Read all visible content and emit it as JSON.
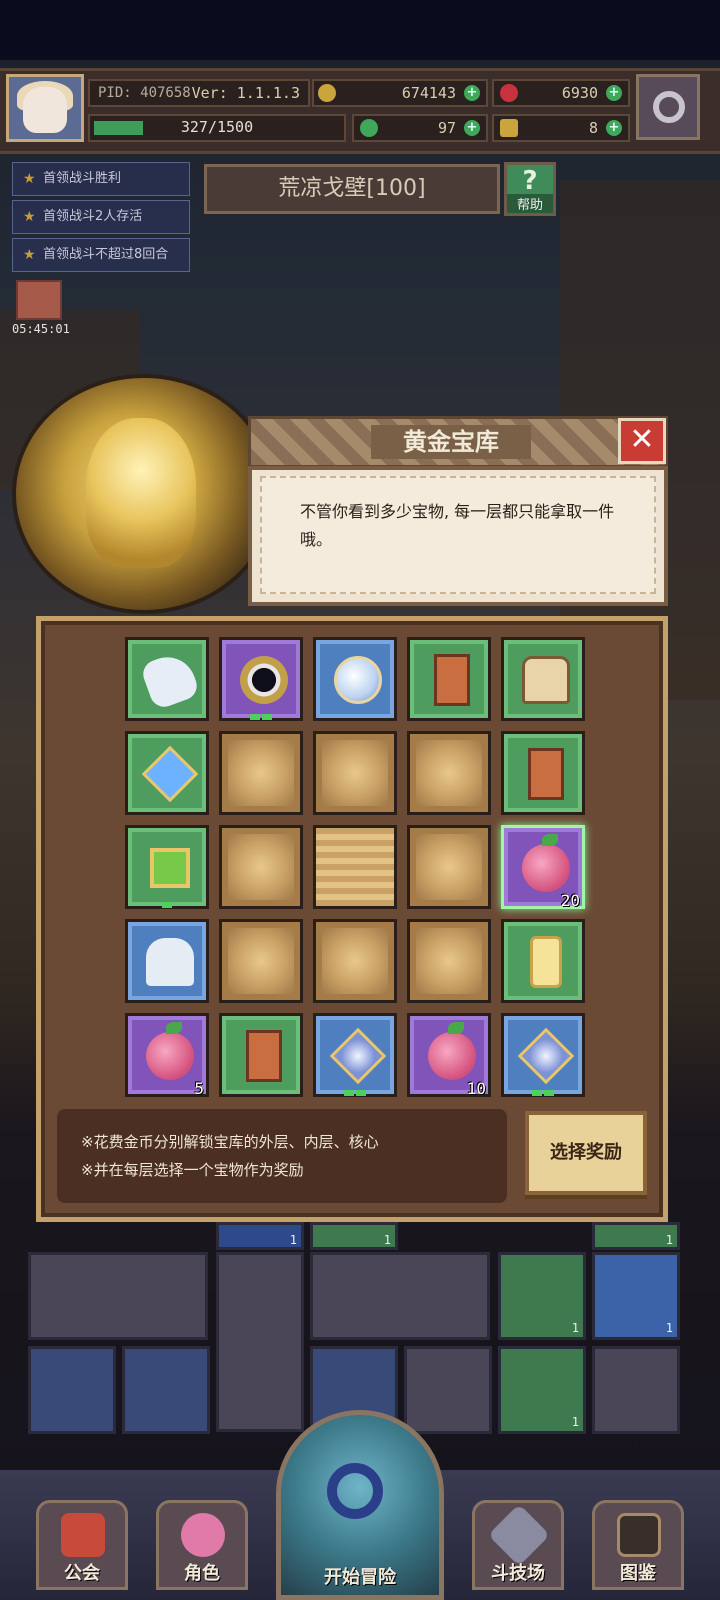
{
  "topbar": {
    "pid": "PID: 407658",
    "version": "Ver: 1.1.1.3",
    "gold": "674143",
    "gems": "6930",
    "xp": "327/1500",
    "xp_fraction": 0.2,
    "clover": "97",
    "key": "8"
  },
  "quests": [
    "首领战斗胜利",
    "首领战斗2人存活",
    "首领战斗不超过8回合"
  ],
  "stage": {
    "title": "荒凉戈壁[100]",
    "help_label": "帮助"
  },
  "chest_timer": "05:45:01",
  "dialog": {
    "title": "黄金宝库",
    "message": "不管你看到多少宝物, 每一层都只能拿取一件哦。"
  },
  "vault": {
    "items": [
      {
        "rarity": "green",
        "icon": "glove-icon"
      },
      {
        "rarity": "purple",
        "icon": "ring-icon",
        "pips": 2
      },
      {
        "rarity": "blue",
        "icon": "crystal-orb-icon"
      },
      {
        "rarity": "green",
        "icon": "copper-card-icon"
      },
      {
        "rarity": "green",
        "icon": "armor-icon"
      },
      {
        "rarity": "green",
        "icon": "sapphire-icon"
      },
      {
        "rarity": "green",
        "icon": "copper-card-icon"
      },
      {
        "rarity": "green",
        "icon": "emerald-icon",
        "pips": 1
      },
      {
        "rarity": "purple",
        "icon": "fruit-icon",
        "count": "20",
        "selected": true
      },
      {
        "rarity": "blue",
        "icon": "statue-icon"
      },
      {
        "rarity": "green",
        "icon": "scroll-icon"
      },
      {
        "rarity": "purple",
        "icon": "fruit-icon",
        "count": "5"
      },
      {
        "rarity": "green",
        "icon": "copper-card-icon"
      },
      {
        "rarity": "blue",
        "icon": "orb-gem-icon",
        "pips": 2
      },
      {
        "rarity": "purple",
        "icon": "fruit-icon",
        "count": "10"
      },
      {
        "rarity": "blue",
        "icon": "orb-gem-icon",
        "pips": 2
      }
    ],
    "note_lines": [
      "※花费金币分别解锁宝库的外层、内层、核心",
      "※并在每层选择一个宝物作为奖励"
    ],
    "select_button": "选择奖励"
  },
  "background_counts": [
    "1",
    "1",
    "1",
    "1",
    "1",
    "1"
  ],
  "nav": {
    "guild": "公会",
    "character": "角色",
    "start": "开始冒险",
    "arena": "斗技场",
    "codex": "图鉴"
  },
  "colors": {
    "green": "#4e9c5e",
    "purple": "#8054b8",
    "blue": "#4f7fbf",
    "gold": "#c9a065"
  }
}
